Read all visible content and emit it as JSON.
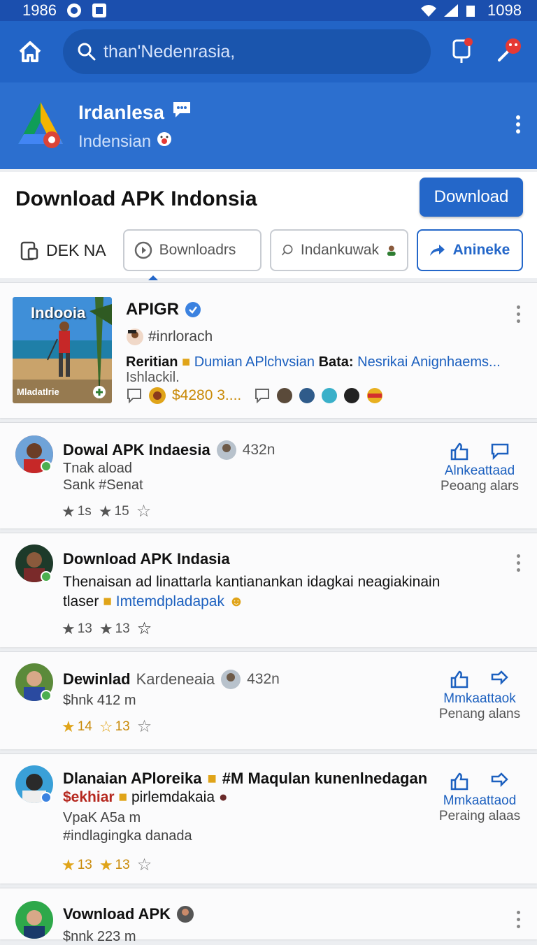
{
  "status_bar": {
    "time": "1986",
    "battery": "1098"
  },
  "search": {
    "value": "than'Nedenrasia,"
  },
  "channel": {
    "name": "Irdanlesa",
    "subtitle": "Indensian"
  },
  "header": {
    "title": "Download APK Indonsia",
    "download_label": "Download"
  },
  "tabs": [
    {
      "label": "DEK NA"
    },
    {
      "label": "Bownloadrs"
    },
    {
      "label": "Indankuwak"
    },
    {
      "label": "Anineke"
    }
  ],
  "featured": {
    "thumb_title": "Indooia",
    "thumb_caption": "Mladatlrie",
    "title": "APIGR",
    "author": "#inrlorach",
    "desc_lead": "Reritian",
    "desc_highlight": "Dumian APlchvsian",
    "desc_label": "Bata:",
    "desc_tail": "Nesrikai Anignhaems...",
    "desc_line2": "Ishlackil.",
    "price": "$4280 3...."
  },
  "posts": [
    {
      "title": "Dowal  APK Indaesia",
      "time": "432n",
      "line1": "Tnak aload",
      "line2": "Sank #Senat",
      "r1": "1s",
      "r2": "15",
      "action1": "Alnkeattaad",
      "action2": "Peoang alars"
    },
    {
      "title": "Download APK  Indasia",
      "line1": "Thenaisan ad linattarla kantianankan idagkai neagiakinain",
      "line2_lead": "tlaser",
      "line2_kw": "Imtemdpladapak",
      "r1": "13",
      "r2": "13"
    },
    {
      "title": "Dewinlad",
      "title_light": "Kardeneaia",
      "time": "432n",
      "line1": "$hnk 412 m",
      "r1": "14",
      "r2": "13",
      "action1": "Mmkaattaok",
      "action2": "Penang alans"
    },
    {
      "title": "Dlanaian APloreika",
      "title_tail": "#M Maqulan kunenlnedagan",
      "line1_red": "$ekhiar",
      "line1_rest": "pirlemdakaia",
      "line2": "VpaK A5a m",
      "line3": "#indlagingka danada",
      "r1": "13",
      "r2": "13",
      "action1": "Mmkaattaod",
      "action2": "Peraing alaas"
    },
    {
      "title": "Vownload APK",
      "line1": "$nnk 223 m"
    }
  ],
  "colors": {
    "primary": "#2264c6",
    "accent": "#2467c9",
    "link": "#1c60bf",
    "gold": "#e0a419"
  }
}
